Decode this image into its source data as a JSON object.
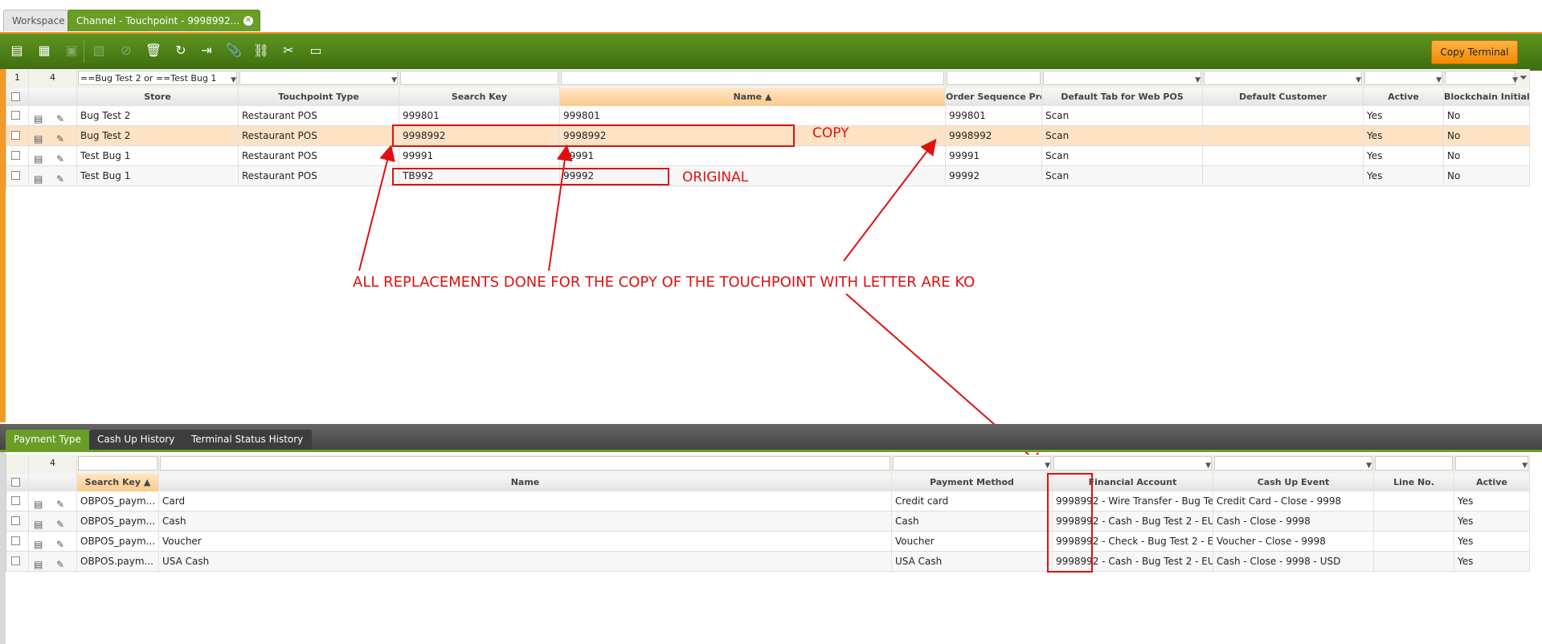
{
  "tabs": {
    "workspace": "Workspace",
    "active": "Channel - Touchpoint - 9998992..."
  },
  "toolbar": {
    "copy_terminal": "Copy Terminal"
  },
  "top_grid": {
    "count": "4",
    "row_num": "1",
    "filter_store": "==Bug Test 2 or ==Test Bug 1",
    "headers": [
      "Store",
      "Touchpoint Type",
      "Search Key",
      "Name ▲",
      "Order Sequence Prefix",
      "Default Tab for Web POS",
      "Default Customer",
      "Active",
      "Blockchain Initialized"
    ],
    "rows": [
      {
        "store": "Bug Test 2",
        "type": "Restaurant POS",
        "key": "999801",
        "name": "999801",
        "prefix": "999801",
        "tab": "Scan",
        "customer": "",
        "active": "Yes",
        "chain": "No"
      },
      {
        "store": "Bug Test 2",
        "type": "Restaurant POS",
        "key": "9998992",
        "name": "9998992",
        "prefix": "9998992",
        "tab": "Scan",
        "customer": "",
        "active": "Yes",
        "chain": "No"
      },
      {
        "store": "Test Bug 1",
        "type": "Restaurant POS",
        "key": "99991",
        "name": "99991",
        "prefix": "99991",
        "tab": "Scan",
        "customer": "",
        "active": "Yes",
        "chain": "No"
      },
      {
        "store": "Test Bug 1",
        "type": "Restaurant POS",
        "key": "TB992",
        "name": "99992",
        "prefix": "99992",
        "tab": "Scan",
        "customer": "",
        "active": "Yes",
        "chain": "No"
      }
    ]
  },
  "annotations": {
    "copy": "COPY",
    "original": "ORIGINAL",
    "main": "ALL REPLACEMENTS DONE FOR THE COPY OF THE TOUCHPOINT WITH LETTER ARE KO"
  },
  "sub_tabs": [
    "Payment Type",
    "Cash Up History",
    "Terminal Status History"
  ],
  "bottom_grid": {
    "count": "4",
    "headers": [
      "Search Key ▲",
      "Name",
      "Payment Method",
      "",
      "Financial Account",
      "Cash Up Event",
      "Line No.",
      "Active"
    ],
    "rows": [
      {
        "key": "OBPOS_paym...",
        "name": "Card",
        "method": "Credit card",
        "code": "9998992",
        "account": "- Wire Transfer - Bug Te...",
        "event": "Credit Card - Close - 9998",
        "line": "",
        "active": "Yes"
      },
      {
        "key": "OBPOS_paym...",
        "name": "Cash",
        "method": "Cash",
        "code": "9998992",
        "account": "- Cash - Bug Test 2 - EUR",
        "event": "Cash - Close - 9998",
        "line": "",
        "active": "Yes"
      },
      {
        "key": "OBPOS_paym...",
        "name": "Voucher",
        "method": "Voucher",
        "code": "9998992",
        "account": "- Check - Bug Test 2 - E...",
        "event": "Voucher - Close - 9998",
        "line": "",
        "active": "Yes"
      },
      {
        "key": "OBPOS.paym...",
        "name": "USA Cash",
        "method": "USA Cash",
        "code": "9998992",
        "account": "- Cash - Bug Test 2 - EUR",
        "event": "Cash - Close - 9998 - USD",
        "line": "",
        "active": "Yes"
      }
    ]
  }
}
